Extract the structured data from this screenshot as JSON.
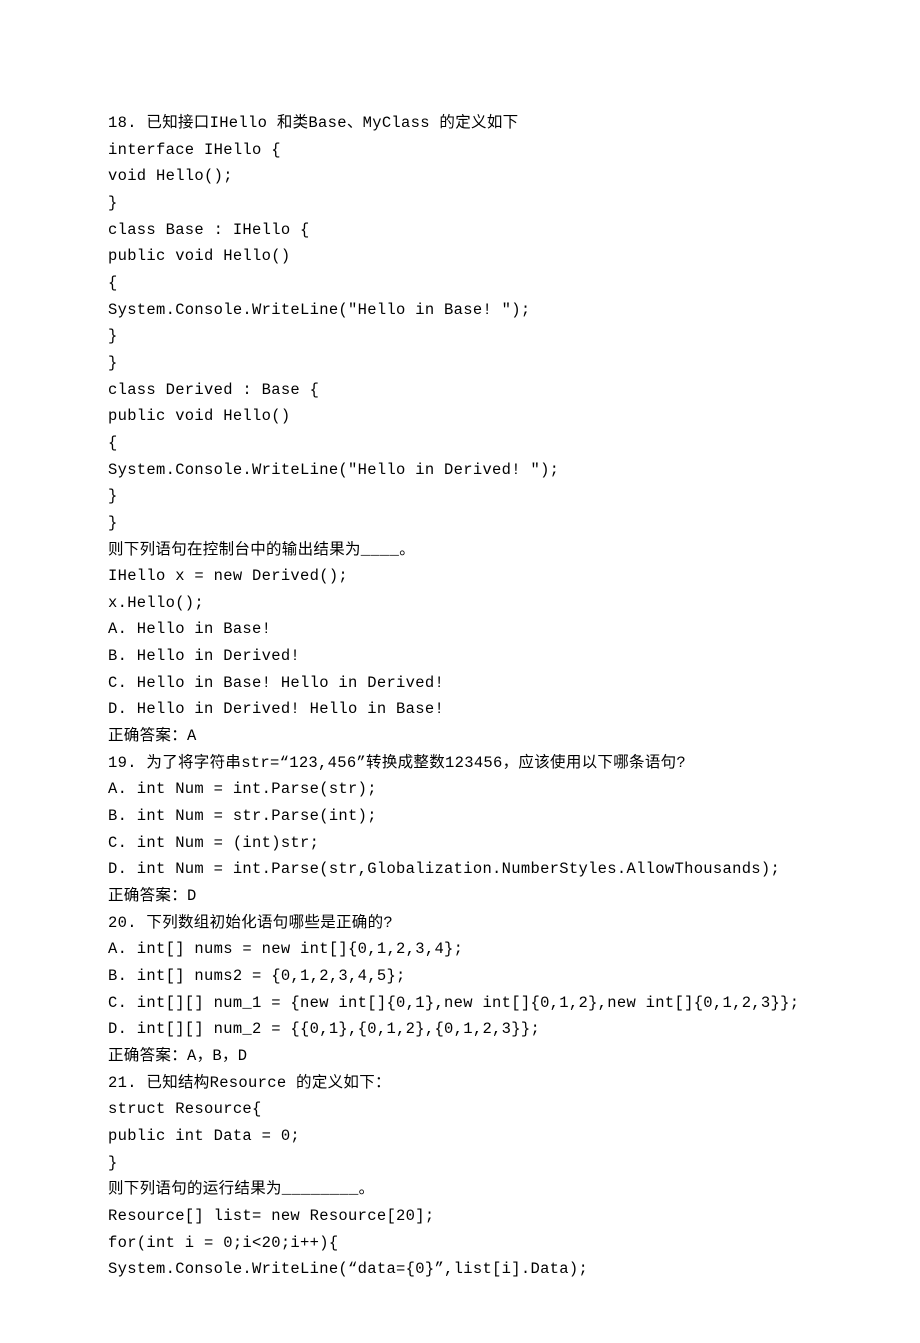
{
  "lines": [
    "18. 已知接口IHello 和类Base、MyClass 的定义如下",
    "interface IHello {",
    "void Hello();",
    "}",
    "class Base : IHello {",
    "public void Hello()",
    "{",
    "System.Console.WriteLine(\"Hello in Base! \");",
    "}",
    "}",
    "class Derived : Base {",
    "public void Hello()",
    "{",
    "System.Console.WriteLine(\"Hello in Derived! \");",
    "}",
    "}",
    "则下列语句在控制台中的输出结果为____。",
    "IHello x = new Derived();",
    "x.Hello();",
    "A. Hello in Base!",
    "B. Hello in Derived!",
    "C. Hello in Base! Hello in Derived!",
    "D. Hello in Derived! Hello in Base!",
    "正确答案：A",
    "19. 为了将字符串str=“123,456”转换成整数123456，应该使用以下哪条语句?",
    "A. int Num = int.Parse(str);",
    "B. int Num = str.Parse(int);",
    "C. int Num = (int)str;",
    "D. int Num = int.Parse(str,Globalization.NumberStyles.AllowThousands);",
    "正确答案：D",
    "20. 下列数组初始化语句哪些是正确的?",
    "A. int[] nums = new int[]{0,1,2,3,4};",
    "B. int[] nums2 = {0,1,2,3,4,5};",
    "C. int[][] num_1 = {new int[]{0,1},new int[]{0,1,2},new int[]{0,1,2,3}};",
    "D. int[][] num_2 = {{0,1},{0,1,2},{0,1,2,3}};",
    "正确答案：A，B，D",
    "21. 已知结构Resource 的定义如下：",
    "struct Resource{",
    "public int Data = 0;",
    "}",
    "则下列语句的运行结果为________。",
    "Resource[] list= new Resource[20];",
    "for(int i = 0;i<20;i++){",
    "System.Console.WriteLine(“data={0}”,list[i].Data);"
  ]
}
